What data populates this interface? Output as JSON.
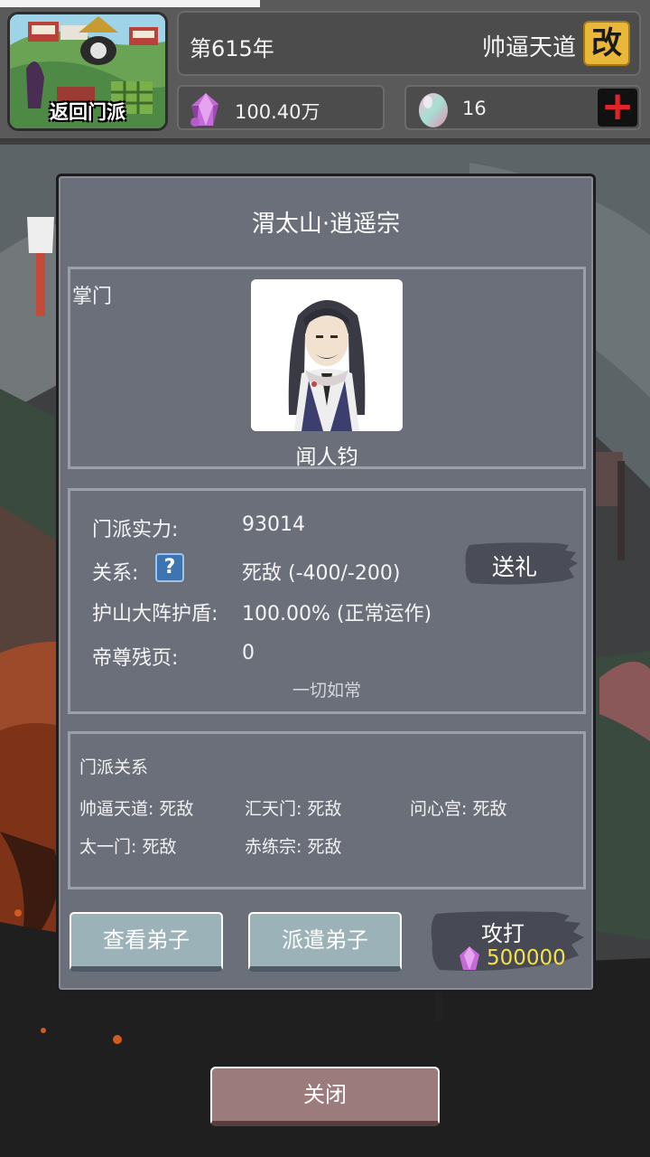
{
  "header": {
    "return_label": "返回门派",
    "year": "第615年",
    "sect_name": "帅逼天道",
    "rename_glyph": "改",
    "crystal_value": "100.40万",
    "egg_value": "16",
    "plus_glyph": "+"
  },
  "dialog": {
    "title": "渭太山·逍遥宗",
    "leader_label": "掌门",
    "leader_name": "闻人钧",
    "info": {
      "strength_label": "门派实力:",
      "strength_value": "93014",
      "relation_label": "关系:",
      "relation_help": "?",
      "relation_value": "死敌  (-400/-200)",
      "shield_label": "护山大阵护盾:",
      "shield_value": "100.00% (正常运作)",
      "pages_label": "帝尊残页:",
      "pages_value": "0",
      "gift_button": "送礼",
      "status_note": "一切如常"
    },
    "relations": {
      "title": "门派关系",
      "items": [
        "帅逼天道: 死敌",
        "汇天门: 死敌",
        "问心宫: 死敌",
        "太一门: 死敌",
        "赤练宗: 死敌"
      ]
    },
    "buttons": {
      "view_disciples": "查看弟子",
      "send_disciples": "派遣弟子",
      "attack": "攻打",
      "attack_cost": "500000"
    }
  },
  "close_button": "关闭",
  "icons": {
    "crystal": "crystal-icon",
    "egg": "spirit-egg-icon",
    "help": "question-icon",
    "plus": "plus-icon"
  },
  "colors": {
    "dialog_bg": "#6b6f7a",
    "panel_border": "#9c9fa8",
    "button_teal": "#9cb2b9",
    "close_button": "#9b7b7b",
    "cost_yellow": "#f5e04b",
    "rename_gold": "#e9b83a",
    "plus_red": "#e2242a"
  }
}
